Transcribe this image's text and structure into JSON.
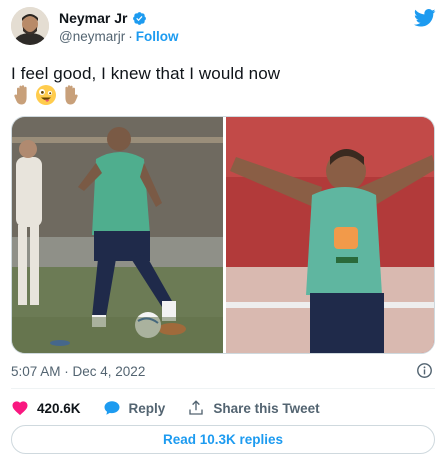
{
  "author": {
    "display_name": "Neymar Jr",
    "handle": "@neymarjr",
    "separator": "·",
    "follow_label": "Follow"
  },
  "tweet": {
    "text": "I feel good, I knew that I would now",
    "emojis": [
      "raised-hand-emoji",
      "zany-face-emoji",
      "raised-hand-emoji"
    ],
    "timestamp": "5:07 AM · Dec 4, 2022"
  },
  "actions": {
    "like_count": "420.6K",
    "reply_label": "Reply",
    "share_label": "Share this Tweet"
  },
  "footer": {
    "read_replies_label": "Read 10.3K replies"
  },
  "colors": {
    "accent": "#1d9bf0",
    "like": "#f91880",
    "secondary_text": "#536471",
    "primary_text": "#0f1419"
  }
}
